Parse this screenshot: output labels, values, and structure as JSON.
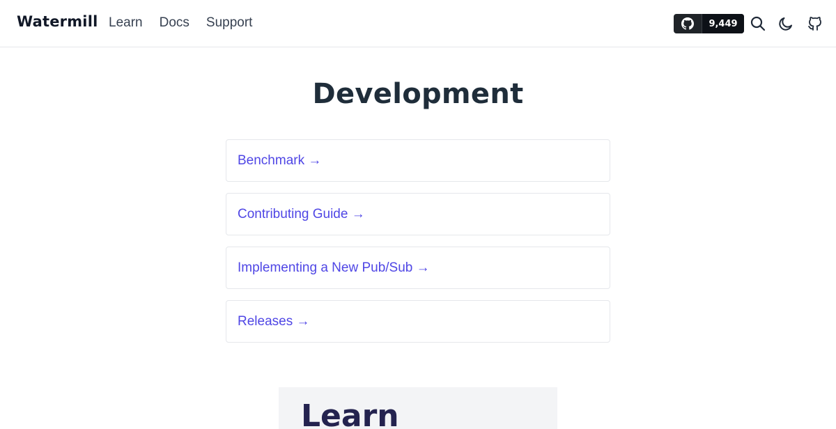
{
  "header": {
    "brand": "Watermill",
    "nav": [
      {
        "label": "Learn"
      },
      {
        "label": "Docs"
      },
      {
        "label": "Support"
      }
    ],
    "github_stars": "9,449",
    "icons": {
      "github_badge": "github-icon",
      "search": "search-icon",
      "theme": "moon-icon",
      "repo": "github-icon"
    }
  },
  "main": {
    "title": "Development",
    "cards": [
      {
        "label": "Benchmark →"
      },
      {
        "label": "Contributing Guide →"
      },
      {
        "label": "Implementing a New Pub/Sub →"
      },
      {
        "label": "Releases →"
      }
    ]
  },
  "footer_section": {
    "title": "Learn"
  },
  "colors": {
    "link": "#4f46e5",
    "title": "#1f2d3a",
    "badge_bg": "#1f2328"
  }
}
